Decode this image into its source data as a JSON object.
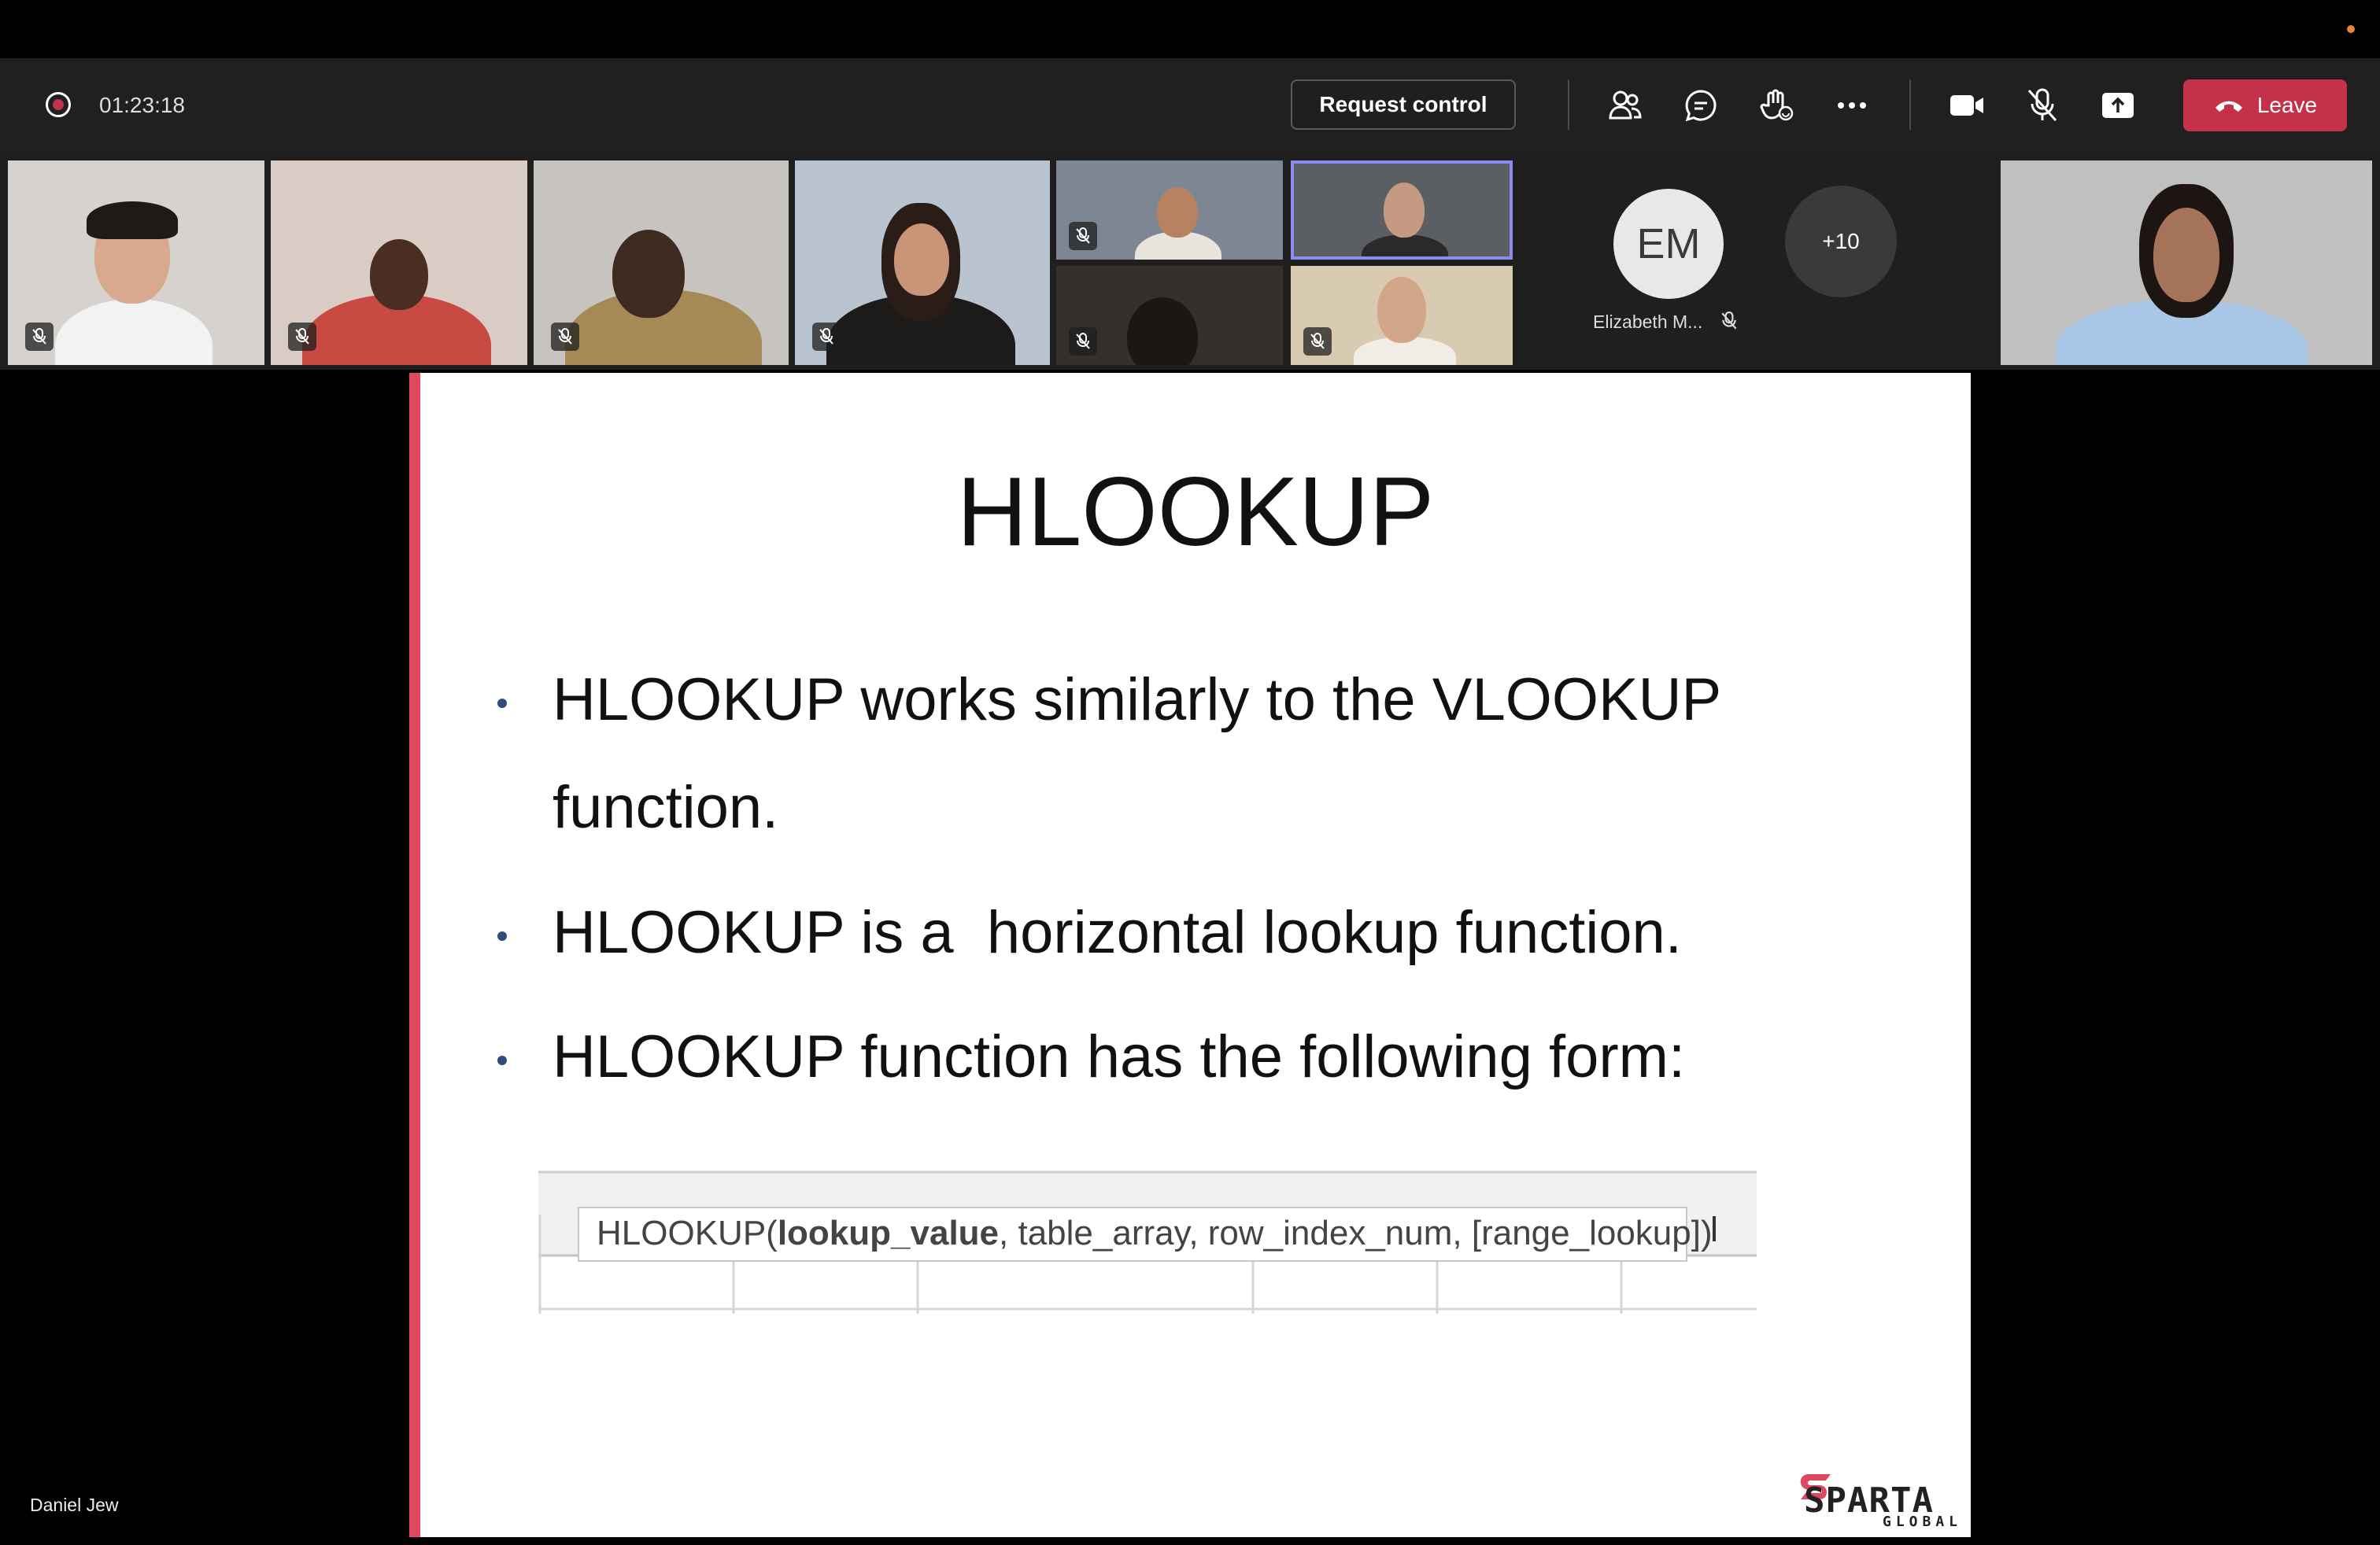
{
  "meeting": {
    "timer": "01:23:18",
    "request_control_label": "Request control",
    "leave_label": "Leave",
    "toolbar_icons": [
      "people-icon",
      "chat-icon",
      "raise-hand-icon",
      "more-icon",
      "camera-icon",
      "mic-off-icon",
      "share-tray-icon"
    ]
  },
  "participants": {
    "avatar_em": {
      "initials": "EM",
      "name": "Elizabeth M..."
    },
    "overflow_label": "+10",
    "presenter_name": "Daniel Jew"
  },
  "slide": {
    "title": "HLOOKUP",
    "bullets": [
      "HLOOKUP works similarly to the VLOOKUP",
      "function.",
      "HLOOKUP is a  horizontal lookup function.",
      "HLOOKUP function has the following form:"
    ],
    "formula": {
      "prefix": "HLOOKUP(",
      "bold_arg": "lookup_value",
      "rest": ", table_array, row_index_num, [range_lookup])"
    },
    "logo_word": "SPARTA",
    "logo_sub": "GLOBAL"
  },
  "colors": {
    "leave": "#c4314b",
    "accent_bar": "#e0485f",
    "selected_tile": "#8b8cf0"
  }
}
